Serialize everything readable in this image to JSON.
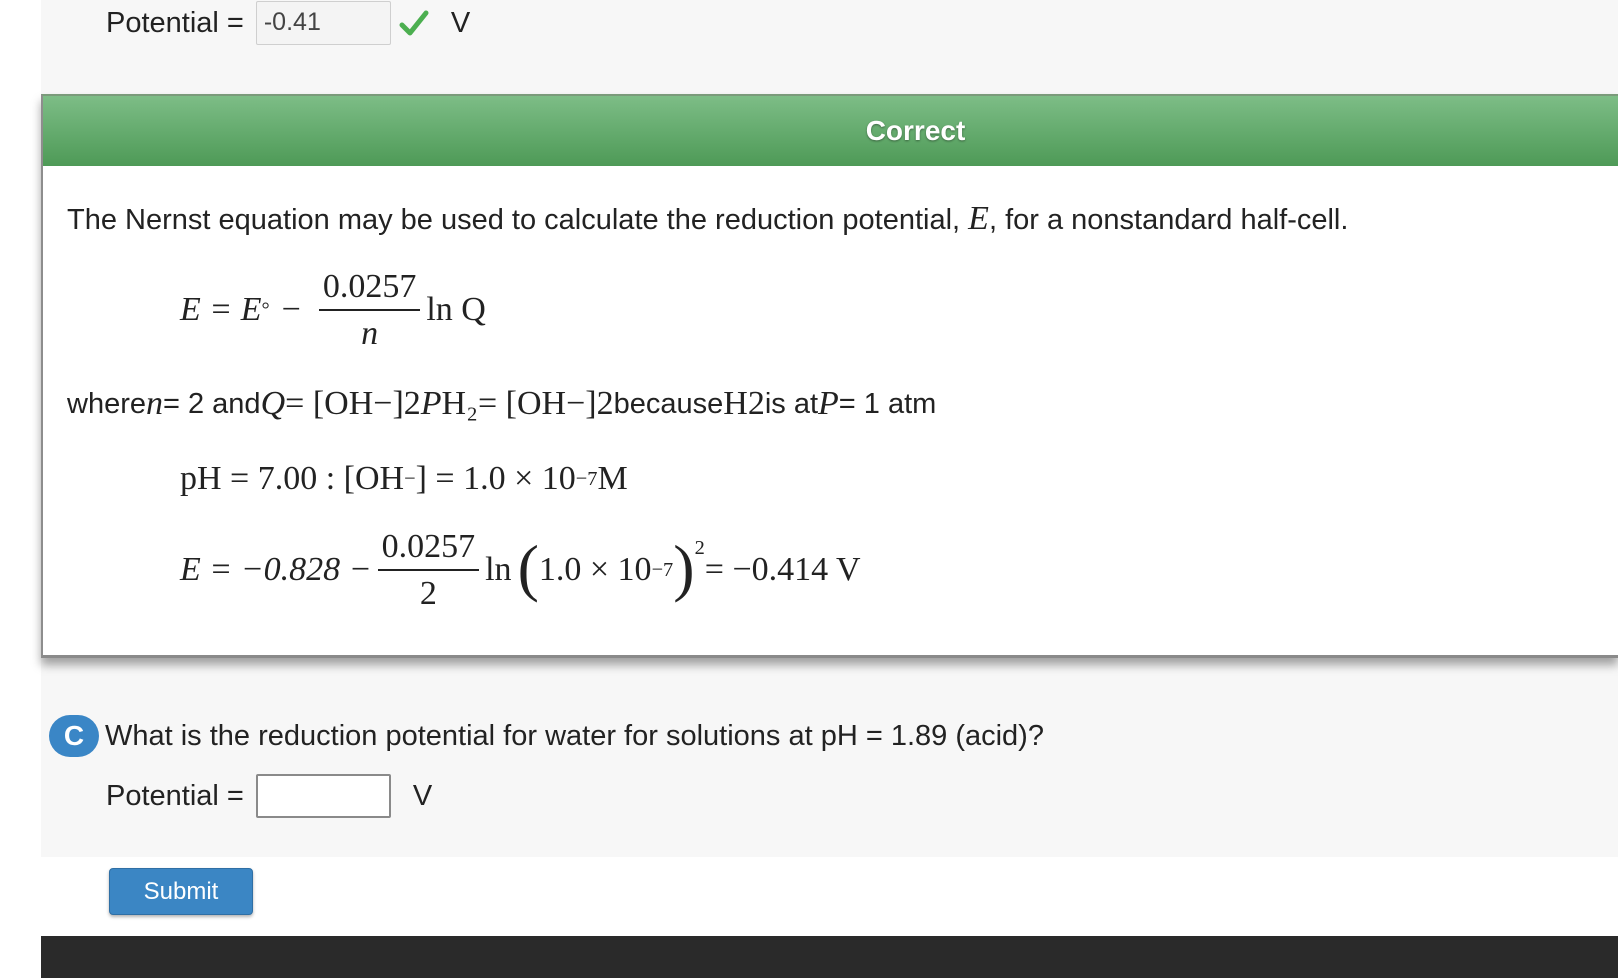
{
  "prev_answer": {
    "label": "Potential =",
    "value": "-0.41",
    "unit": "V",
    "status_icon": "checkmark-icon"
  },
  "feedback": {
    "title": "Correct",
    "intro_text_1": "The Nernst equation may be used to calculate the reduction potential, ",
    "intro_symbol": "E",
    "intro_text_2": ", for a nonstandard half-cell.",
    "nernst_lhs": "E = E",
    "nernst_degree": "°",
    "nernst_minus": "−",
    "nernst_numerator": "0.0257",
    "nernst_denominator": "n",
    "nernst_ln": "ln Q",
    "where_word": "where ",
    "where_n": "n",
    "where_n_value": " = 2 and ",
    "where_Q": "Q",
    "where_eq_expr": " = [OH",
    "where_minus": "−",
    "where_bracket": "]",
    "where_sq": "2",
    "where_P": "P",
    "where_H2sub": "H₂",
    "where_eq_expr2": " = [OH",
    "where_because": " because ",
    "where_H2": "H",
    "where_H2_sub2": "2",
    "where_isat": " is at ",
    "where_P2": "P",
    "where_atm": " = 1 atm",
    "ph_expr_1": "pH = 7.00 :  [OH",
    "ph_expr_2": "] = 1.0 × 10",
    "ph_exp": "−7",
    "ph_unit": " M",
    "calc_lhs": "E = −0.828 −",
    "calc_num": "0.0257",
    "calc_den": "2",
    "calc_ln": "ln",
    "calc_inner": "1.0 × 10",
    "calc_inner_exp": "−7",
    "calc_outer_exp": "2",
    "calc_result": " = −0.414 V"
  },
  "part_c": {
    "badge": "C",
    "question": "What is the reduction potential for water for solutions at pH = 1.89 (acid)?",
    "label": "Potential =",
    "value": "",
    "unit": "V"
  },
  "submit_label": "Submit",
  "colors": {
    "correct_header": "#5aa864",
    "badge_blue": "#3a86c6",
    "submit_blue": "#3b86c4"
  }
}
